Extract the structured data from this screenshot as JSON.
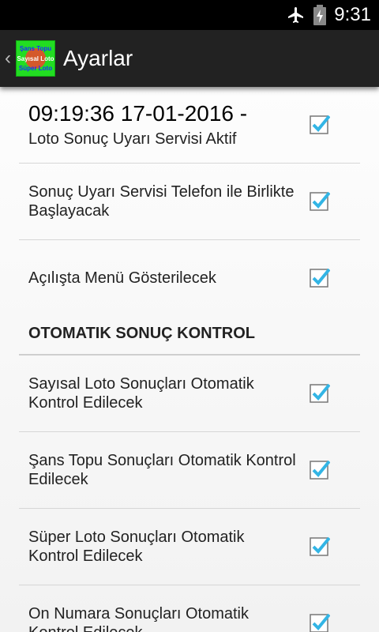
{
  "status_bar": {
    "time": "9:31",
    "icons": [
      "airplane-mode-icon",
      "battery-charging-icon"
    ]
  },
  "action_bar": {
    "up_icon": "‹",
    "app_icon": "loto-app-icon",
    "title": "Ayarlar"
  },
  "settings": {
    "service_status": {
      "title": "09:19:36 17-01-2016 -",
      "summary": "Loto Sonuç Uyarı Servisi Aktif",
      "checked": true
    },
    "start_with_phone": {
      "label": "Sonuç Uyarı Servisi Telefon ile Birlikte Başlayacak",
      "checked": true
    },
    "show_menu": {
      "label": "Açılışta Menü Gösterilecek",
      "checked": true
    },
    "auto_section": {
      "title": "OTOMATIK SONUÇ KONTROL",
      "items": [
        {
          "label": "Sayısal Loto Sonuçları Otomatik Kontrol Edilecek",
          "checked": true
        },
        {
          "label": "Şans Topu Sonuçları Otomatik Kontrol Edilecek",
          "checked": true
        },
        {
          "label": "Süper Loto Sonuçları Otomatik Kontrol Edilecek",
          "checked": true
        },
        {
          "label": "On Numara Sonuçları Otomatik Kontrol Edilecek",
          "checked": true
        }
      ]
    }
  },
  "colors": {
    "check": "#33b5e5",
    "action_bar": "#222222",
    "app_icon_green": "#22dd22"
  }
}
